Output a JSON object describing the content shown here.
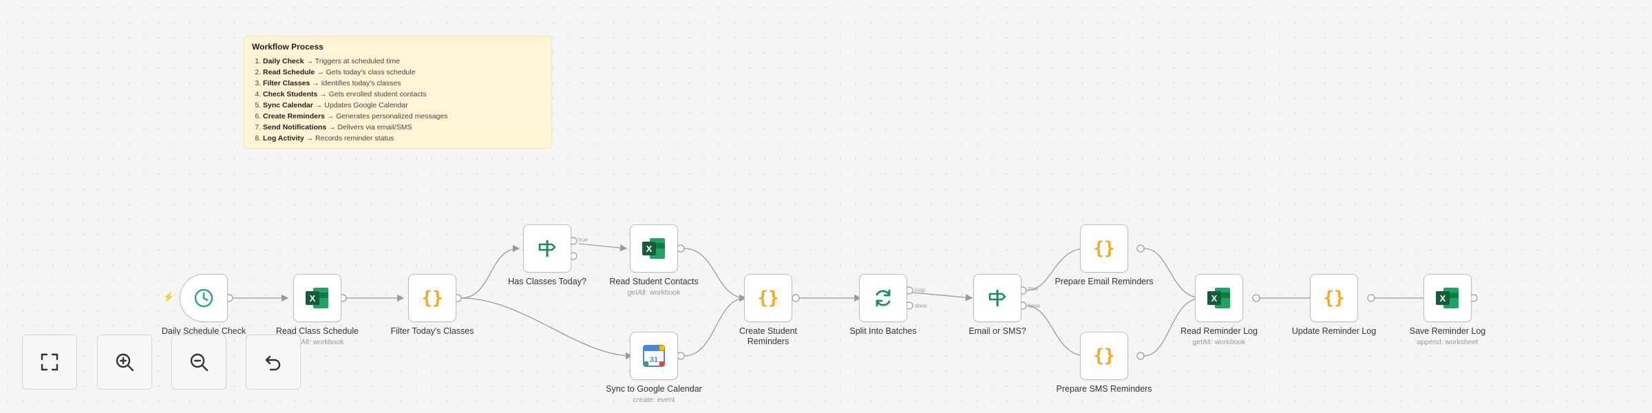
{
  "sticky": {
    "title": "Workflow Process",
    "steps": [
      {
        "bold": "Daily Check",
        "text": " → Triggers at scheduled time"
      },
      {
        "bold": "Read Schedule",
        "text": " → Gets today's class schedule"
      },
      {
        "bold": "Filter Classes",
        "text": " → Identifies today's classes"
      },
      {
        "bold": "Check Students",
        "text": " → Gets enrolled student contacts"
      },
      {
        "bold": "Sync Calendar",
        "text": " → Updates Google Calendar"
      },
      {
        "bold": "Create Reminders",
        "text": " → Generates personalized messages"
      },
      {
        "bold": "Send Notifications",
        "text": " → Delivers via email/SMS"
      },
      {
        "bold": "Log Activity",
        "text": " → Records reminder status"
      }
    ]
  },
  "nodes": {
    "daily_check": {
      "label": "Daily Schedule Check",
      "icon": "clock-icon"
    },
    "read_class_schedule": {
      "label": "Read Class Schedule",
      "sub": "getAll: workbook",
      "icon": "excel-icon"
    },
    "filter_classes": {
      "label": "Filter Today's Classes",
      "icon": "code-braces-icon"
    },
    "has_classes": {
      "label": "Has Classes Today?",
      "icon": "signpost-icon",
      "port_true": "true"
    },
    "read_student_contacts": {
      "label": "Read Student Contacts",
      "sub": "getAll: workbook",
      "icon": "excel-icon"
    },
    "sync_calendar": {
      "label": "Sync to Google Calendar",
      "sub": "create: event",
      "icon": "google-calendar-icon",
      "cal_number": "31"
    },
    "create_reminders": {
      "label": "Create Student Reminders",
      "icon": "code-braces-icon"
    },
    "split_batches": {
      "label": "Split Into Batches",
      "icon": "refresh-icon",
      "port_loop": "loop",
      "port_done": "done"
    },
    "email_or_sms": {
      "label": "Email or SMS?",
      "icon": "signpost-icon",
      "port_true": "true",
      "port_false": "false"
    },
    "prepare_email": {
      "label": "Prepare Email Reminders",
      "icon": "code-braces-icon"
    },
    "prepare_sms": {
      "label": "Prepare SMS Reminders",
      "icon": "code-braces-icon"
    },
    "read_reminder_log": {
      "label": "Read Reminder Log",
      "sub": "getAll: workbook",
      "icon": "excel-icon"
    },
    "update_reminder_log": {
      "label": "Update Reminder Log",
      "icon": "code-braces-icon"
    },
    "save_reminder_log": {
      "label": "Save Reminder Log",
      "sub": "append: worksheet",
      "icon": "excel-icon"
    }
  },
  "controls": [
    {
      "name": "fit-view-button",
      "icon": "fullscreen-icon"
    },
    {
      "name": "zoom-in-button",
      "icon": "zoom-in-icon"
    },
    {
      "name": "zoom-out-button",
      "icon": "zoom-out-icon"
    },
    {
      "name": "reset-button",
      "icon": "undo-icon"
    }
  ],
  "colors": {
    "code": "#f5a623",
    "clock": "#2ca58d",
    "excel": "#1e7145",
    "edge": "#9a9a9a",
    "sticky": "#fff4d6"
  }
}
